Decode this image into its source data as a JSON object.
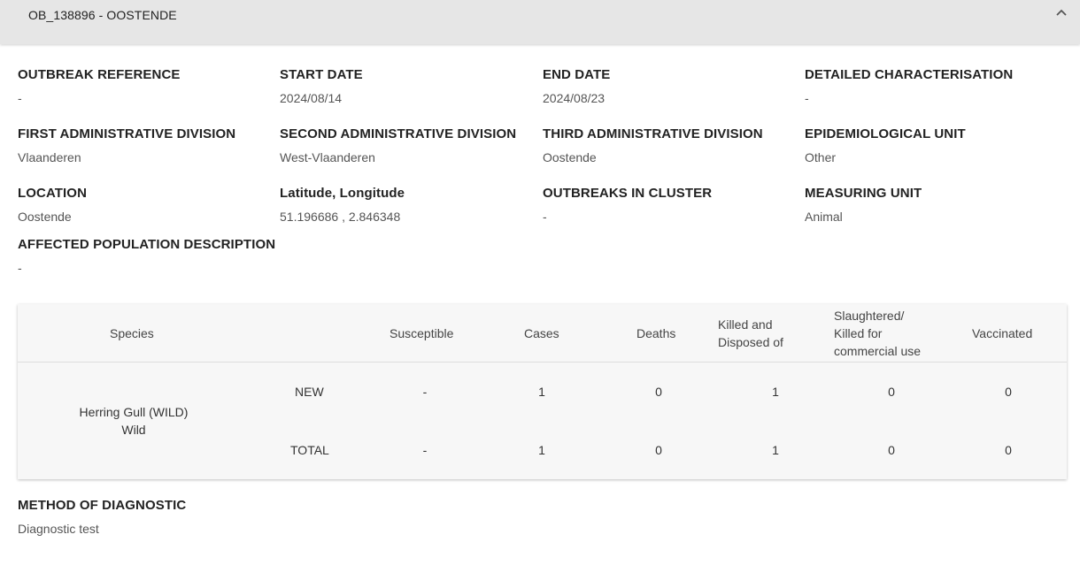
{
  "header": {
    "title": "OB_138896 - OOSTENDE",
    "collapse_icon": "chevron-up-icon"
  },
  "fields": {
    "outbreak_reference": {
      "label": "OUTBREAK REFERENCE",
      "value": "-"
    },
    "start_date": {
      "label": "START DATE",
      "value": "2024/08/14"
    },
    "end_date": {
      "label": "END DATE",
      "value": "2024/08/23"
    },
    "detailed_characterisation": {
      "label": "DETAILED CHARACTERISATION",
      "value": "-"
    },
    "first_admin_division": {
      "label": "FIRST ADMINISTRATIVE DIVISION",
      "value": "Vlaanderen"
    },
    "second_admin_division": {
      "label": "SECOND ADMINISTRATIVE DIVISION",
      "value": "West-Vlaanderen"
    },
    "third_admin_division": {
      "label": "THIRD ADMINISTRATIVE DIVISION",
      "value": "Oostende"
    },
    "epidemiological_unit": {
      "label": "EPIDEMIOLOGICAL UNIT",
      "value": "Other"
    },
    "location": {
      "label": "LOCATION",
      "value": "Oostende"
    },
    "lat_lon": {
      "label": "Latitude, Longitude",
      "value": "51.196686 , 2.846348"
    },
    "outbreaks_in_cluster": {
      "label": "OUTBREAKS IN CLUSTER",
      "value": "-"
    },
    "measuring_unit": {
      "label": "MEASURING UNIT",
      "value": "Animal"
    },
    "affected_population": {
      "label": "AFFECTED POPULATION DESCRIPTION",
      "value": "-"
    },
    "method_of_diagnostic": {
      "label": "METHOD OF DIAGNOSTIC",
      "value": "Diagnostic test"
    }
  },
  "table": {
    "headers": {
      "species": "Species",
      "susceptible": "Susceptible",
      "cases": "Cases",
      "deaths": "Deaths",
      "killed_line1": "Killed and",
      "killed_line2": "Disposed of",
      "slaughtered_line1": "Slaughtered/",
      "slaughtered_line2": "Killed for",
      "slaughtered_line3": "commercial use",
      "vaccinated": "Vaccinated"
    },
    "species_line1": "Herring Gull (WILD)",
    "species_line2": "Wild",
    "rows": [
      {
        "label": "NEW",
        "susceptible": "-",
        "cases": "1",
        "deaths": "0",
        "killed": "1",
        "slaughtered": "0",
        "vaccinated": "0"
      },
      {
        "label": "TOTAL",
        "susceptible": "-",
        "cases": "1",
        "deaths": "0",
        "killed": "1",
        "slaughtered": "0",
        "vaccinated": "0"
      }
    ]
  }
}
